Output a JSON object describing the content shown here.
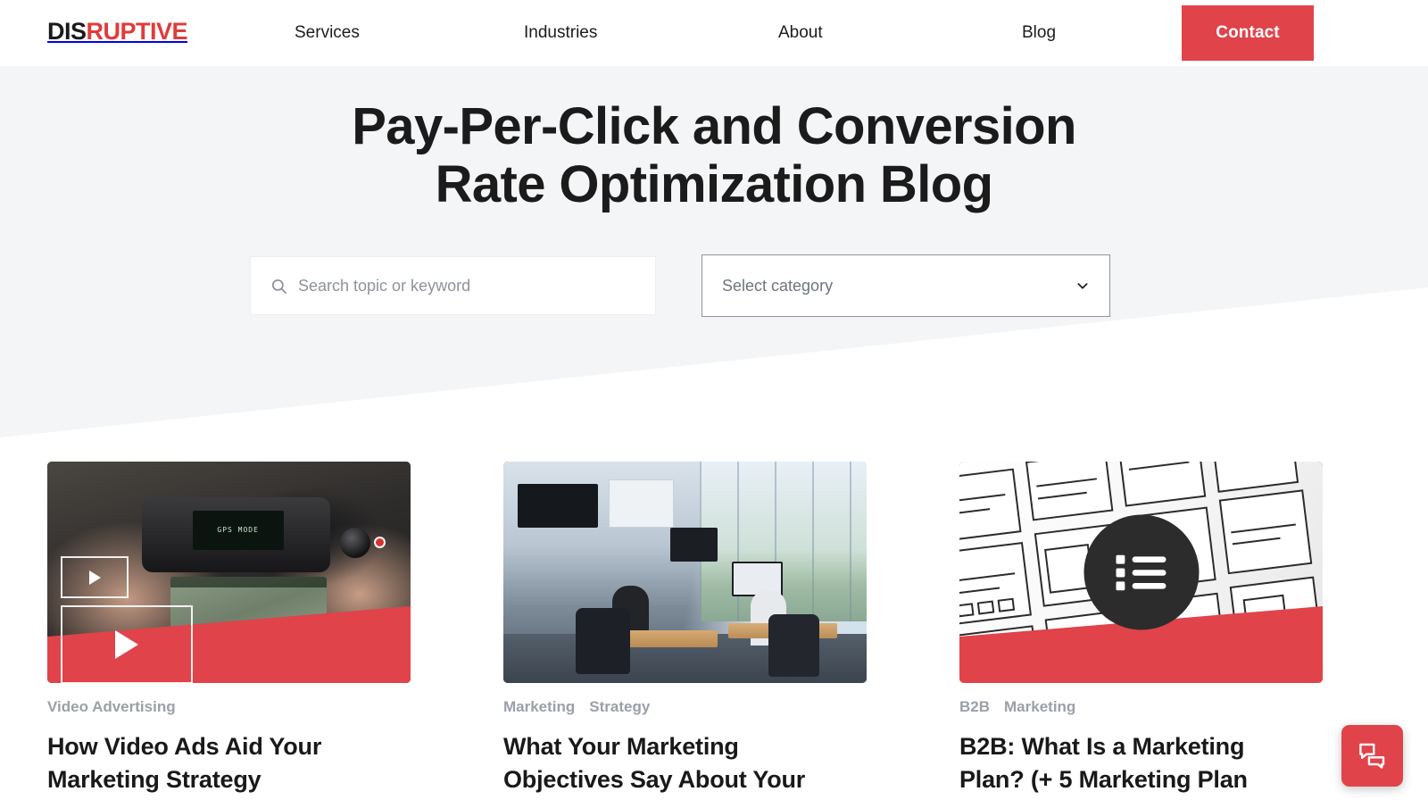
{
  "nav": {
    "logo": {
      "part_dark": "DIS",
      "part_red": "RUPTIVE",
      "full": "DISRUPTIVE"
    },
    "links": [
      {
        "label": "Services"
      },
      {
        "label": "Industries"
      },
      {
        "label": "About"
      },
      {
        "label": "Blog"
      }
    ],
    "cta_label": "Contact"
  },
  "hero": {
    "title_line1": "Pay-Per-Click and Conversion",
    "title_line2": "Rate Optimization Blog",
    "search": {
      "placeholder": "Search topic or keyword",
      "value": "",
      "icon": "search-icon"
    },
    "category": {
      "selected": "Select category",
      "icon": "chevron-down-icon"
    }
  },
  "posts": [
    {
      "tags": [
        "Video Advertising"
      ],
      "title_line1": "How Video Ads Aid Your",
      "title_line2": "Marketing Strategy",
      "media": {
        "kind": "drone-controller-photo",
        "overlay": "play-button-outlines",
        "screen_text": "GPS MODE",
        "has_red_wedge": true
      }
    },
    {
      "tags": [
        "Marketing",
        "Strategy"
      ],
      "title_line1": "What Your Marketing",
      "title_line2": "Objectives Say About Your",
      "media": {
        "kind": "open-office-photo",
        "overlay": "none",
        "has_red_wedge": false
      }
    },
    {
      "tags": [
        "B2B",
        "Marketing"
      ],
      "title_line1": "B2B: What Is a Marketing",
      "title_line2": "Plan? (+ 5 Marketing Plan",
      "media": {
        "kind": "wireframe-sketches-photo",
        "overlay": "list-badge-icon",
        "has_red_wedge": true
      }
    }
  ],
  "chat": {
    "icon": "chat-bubbles-icon",
    "label": "Open chat"
  },
  "colors": {
    "brand_red": "#e0434a",
    "logo_red": "#e03b3b",
    "hero_bg": "#f4f5f7",
    "page_bg": "#ffffff",
    "text_dark": "#191919",
    "tag_grey": "#9aa0a8",
    "placeholder_grey": "#8e939b",
    "select_border": "#8f949c",
    "badge_dark": "#2c2c2c"
  }
}
